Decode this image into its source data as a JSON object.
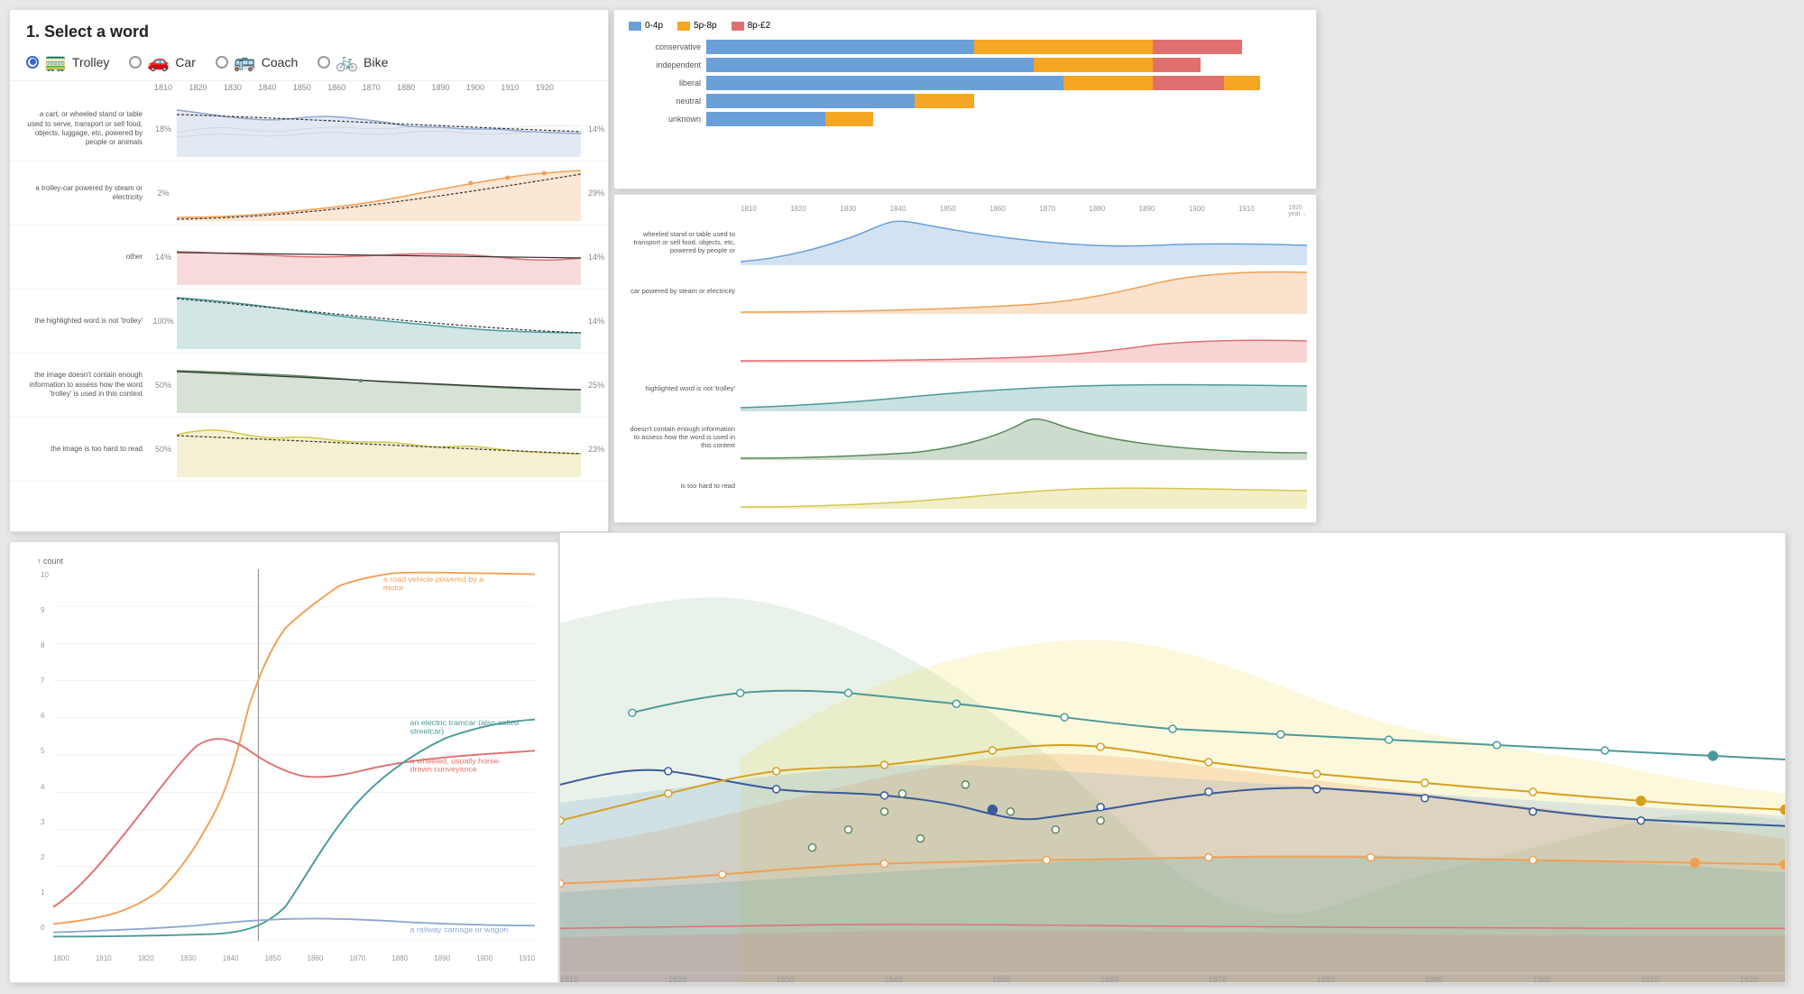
{
  "title": "1. Select a word",
  "words": [
    {
      "label": "Trolley",
      "active": true,
      "icon": "🚃"
    },
    {
      "label": "Car",
      "active": false,
      "icon": "🚗"
    },
    {
      "label": "Coach",
      "active": false,
      "icon": "🚌"
    },
    {
      "label": "Bike",
      "active": false,
      "icon": "🚲"
    }
  ],
  "years": [
    "1810",
    "1820",
    "1830",
    "1840",
    "1850",
    "1860",
    "1870",
    "1880",
    "1890",
    "1900",
    "1910",
    "1920"
  ],
  "senses": [
    {
      "label": "a cart, or wheeled stand or table used to serve, transport or sell food, objects, luggage, etc, powered by people or animals",
      "color": "#8fa8d0",
      "pct_left": "18%",
      "pct_right": "14%"
    },
    {
      "label": "a trolley-car powered by steam or electricity",
      "color": "#f0a055",
      "pct_left": "2%",
      "pct_right": "29%"
    },
    {
      "label": "other",
      "color": "#e07070",
      "pct_left": "14%",
      "pct_right": "14%"
    },
    {
      "label": "the highlighted word is not 'trolley'",
      "color": "#4a9a9a",
      "pct_left": "100%",
      "pct_right": "14%"
    },
    {
      "label": "the image doesn't contain enough information to assess how the word 'trolley' is used in this context",
      "color": "#5a8a5a",
      "pct_left": "50%",
      "pct_right": "25%"
    },
    {
      "label": "the image is too hard to read",
      "color": "#d4c84a",
      "pct_left": "50%",
      "pct_right": "23%"
    }
  ],
  "legend": {
    "items": [
      {
        "label": "0-4p",
        "color": "#6a9fd8"
      },
      {
        "label": "5p-8p",
        "color": "#f5a623"
      },
      {
        "label": "8p-£2",
        "color": "#e07070"
      }
    ]
  },
  "stacked_categories": [
    "conservative",
    "independent",
    "liberal",
    "neutral",
    "unknown"
  ],
  "mini_sense_labels": [
    "wheeled stand or table used to transport or sell food, objects, etc, powered by people or",
    "car powered by steam or electricity",
    "",
    "highlighted word is not 'trolley'",
    "doesn't contain enough information to assess how the word is used in this context",
    "is too hard to read"
  ],
  "mini_years": [
    "1810",
    "1820",
    "1830",
    "1840",
    "1850",
    "1860",
    "1870",
    "1880",
    "1890",
    "1900",
    "1910",
    "1920"
  ],
  "line_chart": {
    "title": "↑ count",
    "y_max": 10,
    "lines": [
      {
        "label": "a road vehicle powered by a motor",
        "color": "#f0a055"
      },
      {
        "label": "an electric tramcar (also called streetcar)",
        "color": "#4a9a9a"
      },
      {
        "label": "a wheeled, usually horse-drawn conveyance",
        "color": "#e07070"
      },
      {
        "label": "a railway carriage or wagon",
        "color": "#8fa8d0"
      }
    ]
  }
}
